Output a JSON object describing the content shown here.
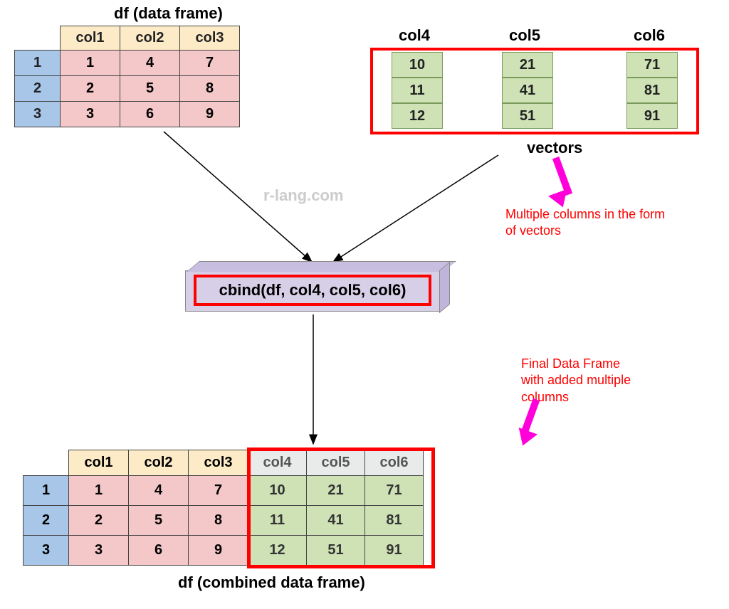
{
  "titles": {
    "top": "df (data frame)",
    "vectors": "vectors",
    "bottom": "df (combined data frame)",
    "watermark": "r-lang.com"
  },
  "df": {
    "headers": [
      "col1",
      "col2",
      "col3"
    ],
    "rows": [
      {
        "idx": "1",
        "vals": [
          "1",
          "4",
          "7"
        ]
      },
      {
        "idx": "2",
        "vals": [
          "2",
          "5",
          "8"
        ]
      },
      {
        "idx": "3",
        "vals": [
          "3",
          "6",
          "9"
        ]
      }
    ]
  },
  "vectors": {
    "labels": [
      "col4",
      "col5",
      "col6"
    ],
    "col4": [
      "10",
      "11",
      "12"
    ],
    "col5": [
      "21",
      "41",
      "51"
    ],
    "col6": [
      "71",
      "81",
      "91"
    ]
  },
  "cbind": {
    "code": "cbind(df, col4, col5, col6)"
  },
  "annotations": {
    "multi_cols_1": "Multiple columns in the form",
    "multi_cols_2": "of vectors",
    "final_1": "Final Data Frame",
    "final_2": "with added multiple",
    "final_3": "columns"
  },
  "combined": {
    "headers_pink": [
      "col1",
      "col2",
      "col3"
    ],
    "headers_grey": [
      "col4",
      "col5",
      "col6"
    ],
    "rows": [
      {
        "idx": "1",
        "pink": [
          "1",
          "4",
          "7"
        ],
        "green": [
          "10",
          "21",
          "71"
        ]
      },
      {
        "idx": "2",
        "pink": [
          "2",
          "5",
          "8"
        ],
        "green": [
          "11",
          "41",
          "81"
        ]
      },
      {
        "idx": "3",
        "pink": [
          "3",
          "6",
          "9"
        ],
        "green": [
          "12",
          "51",
          "91"
        ]
      }
    ]
  },
  "chart_data": {
    "type": "table",
    "title": "cbind diagram: add multiple vector columns to a data frame",
    "input_df": {
      "columns": [
        "col1",
        "col2",
        "col3"
      ],
      "data": [
        [
          1,
          4,
          7
        ],
        [
          2,
          5,
          8
        ],
        [
          3,
          6,
          9
        ]
      ]
    },
    "vectors": {
      "col4": [
        10,
        11,
        12
      ],
      "col5": [
        21,
        41,
        51
      ],
      "col6": [
        71,
        81,
        91
      ]
    },
    "operation": "cbind(df, col4, col5, col6)",
    "result_df": {
      "columns": [
        "col1",
        "col2",
        "col3",
        "col4",
        "col5",
        "col6"
      ],
      "data": [
        [
          1,
          4,
          7,
          10,
          21,
          71
        ],
        [
          2,
          5,
          8,
          11,
          41,
          81
        ],
        [
          3,
          6,
          9,
          12,
          51,
          91
        ]
      ]
    }
  }
}
